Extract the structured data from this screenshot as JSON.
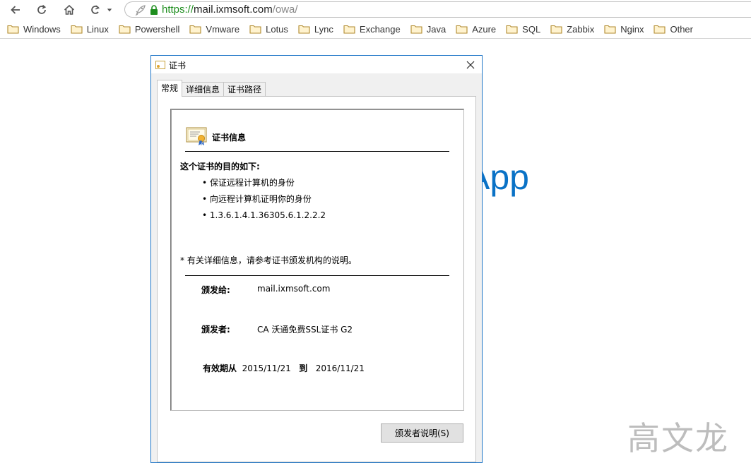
{
  "browser": {
    "url_scheme": "https://",
    "url_host": "mail.ixmsoft.com",
    "url_path": "/owa/",
    "icons": [
      "back-icon",
      "reload-icon",
      "home-icon",
      "history-undo-icon",
      "dropdown-caret-icon",
      "rocket-icon",
      "lock-icon"
    ],
    "lock_color": "#1e8e1e"
  },
  "bookmarks": [
    {
      "label": "Windows"
    },
    {
      "label": "Linux"
    },
    {
      "label": "Powershell"
    },
    {
      "label": "Vmware"
    },
    {
      "label": "Lotus"
    },
    {
      "label": "Lync"
    },
    {
      "label": "Exchange"
    },
    {
      "label": "Java"
    },
    {
      "label": "Azure"
    },
    {
      "label": "SQL"
    },
    {
      "label": "Zabbix"
    },
    {
      "label": "Nginx"
    },
    {
      "label": "Other"
    }
  ],
  "page": {
    "background_title": "App",
    "title_color": "#0a72c6"
  },
  "dialog": {
    "title": "证书",
    "tabs": [
      {
        "label": "常规",
        "active": true
      },
      {
        "label": "详细信息",
        "active": false
      },
      {
        "label": "证书路径",
        "active": false
      }
    ],
    "heading": "证书信息",
    "purpose_heading": "这个证书的目的如下:",
    "purposes": [
      "保证远程计算机的身份",
      "向远程计算机证明你的身份",
      "1.3.6.1.4.1.36305.6.1.2.2.2"
    ],
    "footnote": "* 有关详细信息，请参考证书颁发机构的说明。",
    "issued_to_label": "颁发给:",
    "issued_to_value": "mail.ixmsoft.com",
    "issued_by_label": "颁发者:",
    "issued_by_value": "CA 沃通免费SSL证书 G2",
    "validity_label": "有效期从",
    "valid_from": "2015/11/21",
    "validity_to_word": "到",
    "valid_to": "2016/11/21",
    "issuer_statement_button": "颁发者说明(S)"
  },
  "watermark": "高文龙"
}
